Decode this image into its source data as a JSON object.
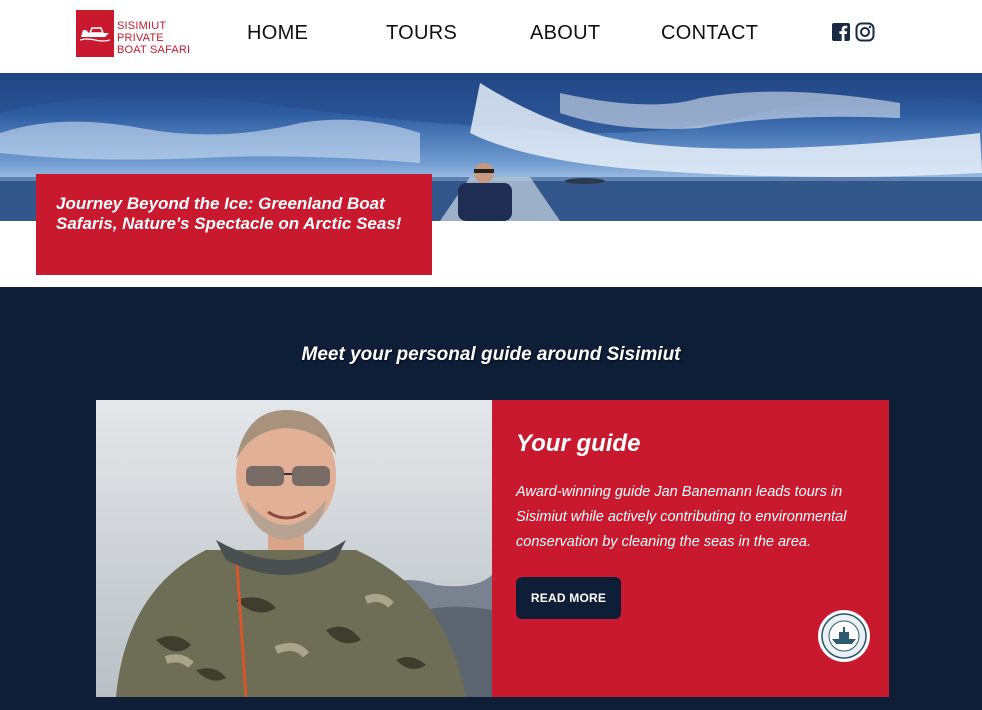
{
  "brand": {
    "line1": "SISIMIUT",
    "line2": "PRIVATE",
    "line3": "BOAT SAFARI"
  },
  "nav": {
    "home": "HOME",
    "tours": "TOURS",
    "about": "ABOUT",
    "contact": "CONTACT"
  },
  "social": {
    "facebook_icon": "facebook-icon",
    "instagram_icon": "instagram-icon"
  },
  "hero": {
    "headline": "Journey Beyond the Ice: Greenland Boat Safaris, Nature's Spectacle on Arctic Seas!"
  },
  "guide_section": {
    "title": "Meet your personal guide around Sisimiut",
    "card_title": "Your guide",
    "description": "Award-winning guide Jan Banemann leads tours in Sisimiut while actively contributing to environmental conservation by cleaning the seas in the area.",
    "button": "READ MORE"
  },
  "colors": {
    "brand_red": "#c8192f",
    "navy": "#0f1e37",
    "white": "#ffffff"
  }
}
